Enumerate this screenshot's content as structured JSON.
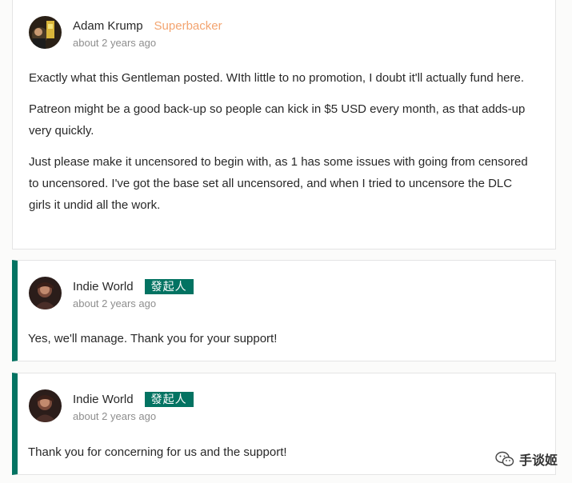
{
  "comments": [
    {
      "author": "Adam Krump",
      "badge": "Superbacker",
      "time": "about 2 years ago",
      "paragraphs": [
        "Exactly what this Gentleman posted. WIth little to no promotion, I doubt it'll actually fund here.",
        "Patreon might be a good back-up so people can kick in $5 USD every month, as that adds-up very quickly.",
        "Just please make it uncensored to begin with, as 1 has some issues with going from censored to uncensored. I've got the base set all uncensored, and when I tried to uncensore the DLC girls it undid all the work."
      ]
    },
    {
      "author": "Indie World",
      "badge": "發起人",
      "time": "about 2 years ago",
      "paragraphs": [
        "Yes, we'll manage. Thank you for your support!"
      ]
    },
    {
      "author": "Indie World",
      "badge": "發起人",
      "time": "about 2 years ago",
      "paragraphs": [
        "Thank you for concerning for us and the support!"
      ]
    }
  ],
  "watermark": {
    "text": "手谈姬",
    "icon": "wechat-icon"
  },
  "colors": {
    "creator_accent": "#037362",
    "superbacker": "#f3a470",
    "muted_text": "#8e8e8e"
  }
}
